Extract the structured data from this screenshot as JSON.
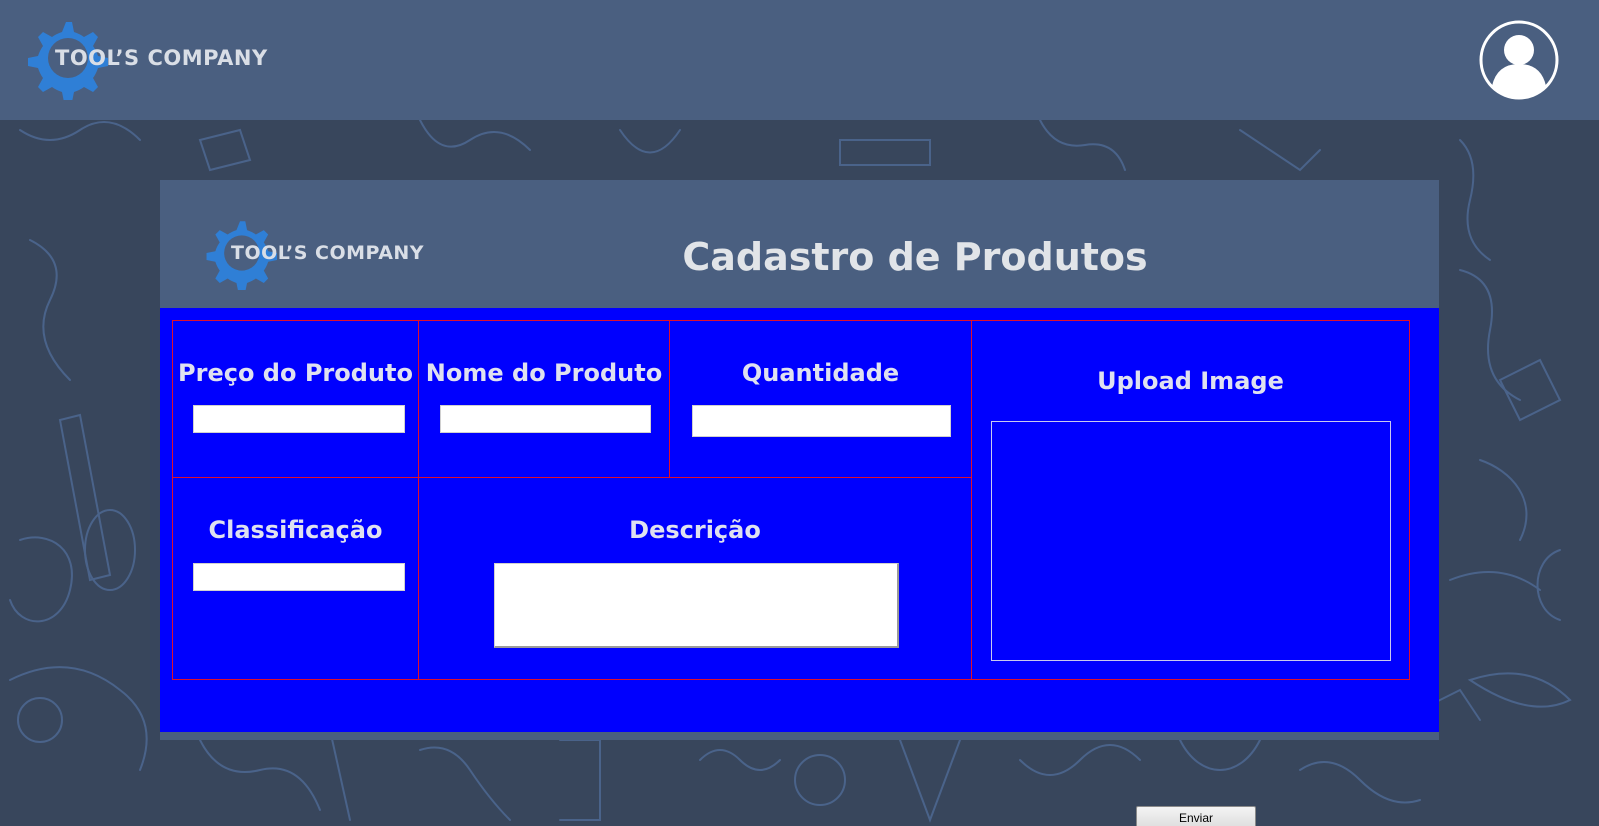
{
  "header": {
    "logo_text": "TOOL’S COMPANY",
    "profile": "user-avatar-icon"
  },
  "form": {
    "logo_text": "TOOL’S COMPANY",
    "title": "Cadastro de Produtos",
    "fields": {
      "price": {
        "label": "Preço do Produto",
        "value": ""
      },
      "name": {
        "label": "Nome do Produto",
        "value": ""
      },
      "quantity": {
        "label": "Quantidade",
        "value": ""
      },
      "classification": {
        "label": "Classificação",
        "value": ""
      },
      "description": {
        "label": "Descrição",
        "value": ""
      }
    },
    "upload": {
      "label": "Upload Image"
    },
    "submit_label": "Enviar"
  },
  "colors": {
    "page_background": "#38465c",
    "header_background": "#4a5f80",
    "form_background": "#0000fe",
    "cell_border": "#e0102a",
    "logo_gear": "#2f7fd6",
    "label_text": "#dfe1f0"
  },
  "icons": [
    "gear-logo-icon",
    "user-avatar-icon"
  ]
}
